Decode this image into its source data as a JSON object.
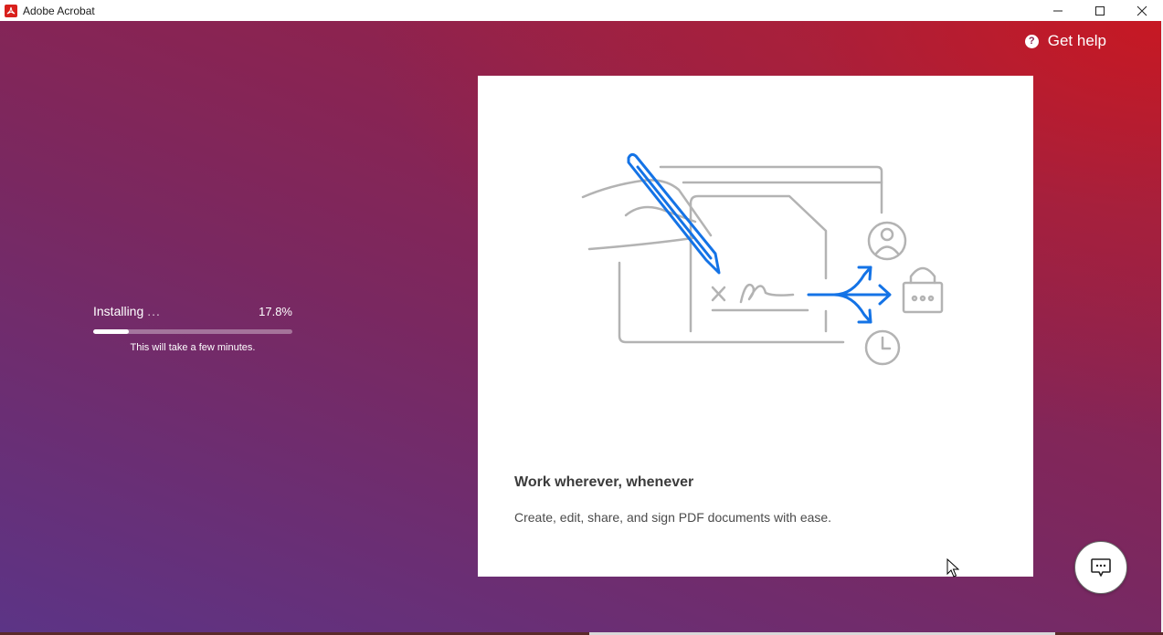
{
  "window": {
    "title": "Adobe Acrobat",
    "controls": {
      "minimize": "minimize-icon",
      "maximize": "maximize-icon",
      "close": "close-icon"
    }
  },
  "header": {
    "help_label": "Get help",
    "help_icon": "question-icon"
  },
  "install": {
    "label": "Installing",
    "dots": "...",
    "percent_text": "17.8%",
    "progress": 0.178,
    "note": "This will take a few minutes."
  },
  "card": {
    "title": "Work wherever, whenever",
    "text": "Create, edit, share, and sign PDF documents with ease."
  },
  "chat": {
    "icon": "chat-icon"
  },
  "colors": {
    "accent_blue": "#1473e6",
    "brand_red": "#d9201c",
    "bg_top_right": "#c81822",
    "bg_bottom_left": "#5c3486"
  }
}
